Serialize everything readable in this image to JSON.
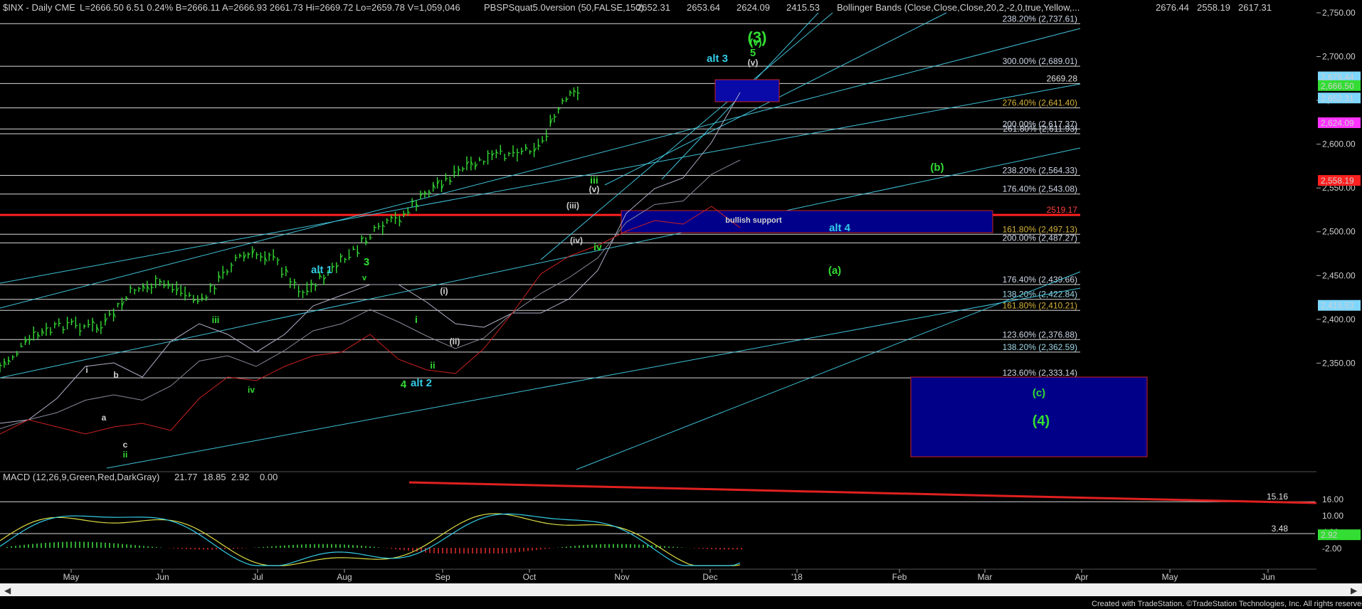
{
  "header": {
    "symbol": "$INX - Daily  CME",
    "quote": "L=2666.50  6.51  0.24%  B=2666.11  A=2666.93  2661.73  Hi=2669.72  Lo=2659.78  V=1,059,046",
    "indicator": "PBSPSquat5.0version (50,FALSE,150)",
    "ind_values": [
      {
        "text": "2652.31",
        "color": "#7fd7ff"
      },
      {
        "text": "2653.64",
        "color": "#ffff66"
      },
      {
        "text": "2624.09",
        "color": "#ff66ff"
      },
      {
        "text": "2415.53",
        "color": "#7fd7ff"
      }
    ],
    "bollinger": "Bollinger Bands (Close,Close,Close,20,2,-2,0,true,Yellow,...",
    "boll_values": [
      {
        "text": "2676.44",
        "color": "#7fd7ff"
      },
      {
        "text": "2558.19",
        "color": "#ff4040"
      },
      {
        "text": "2617.31",
        "color": "#aaaaaa"
      }
    ]
  },
  "colors": {
    "background": "#000000",
    "bars": "#33dd33",
    "channel": "#3fc1d9",
    "wave_green": "#33dd33",
    "wave_cyan": "#33cce6",
    "support_box": "#00008b",
    "box_border": "#cc2222",
    "red_line": "#ff2020"
  },
  "chart_data": [
    {
      "type": "line",
      "name": "price",
      "title": "$INX - Daily",
      "x_axis": {
        "ticks": [
          "May",
          "Jun",
          "Jul",
          "Aug",
          "Sep",
          "Oct",
          "Nov",
          "Dec",
          "'18",
          "Feb",
          "Mar",
          "Apr",
          "May",
          "Jun"
        ]
      },
      "y_axis": {
        "ticks": [
          2350,
          2400,
          2450,
          2500,
          2550,
          2600,
          2650,
          2700,
          2750
        ],
        "ylim": [
          2320,
          2760
        ]
      },
      "grid": false,
      "series": [
        {
          "name": "$INX",
          "x": [
            "2017-04-10",
            "2017-04-24",
            "2017-05-08",
            "2017-05-22",
            "2017-06-05",
            "2017-06-19",
            "2017-07-03",
            "2017-07-17",
            "2017-07-31",
            "2017-08-14",
            "2017-08-28",
            "2017-09-11",
            "2017-09-25",
            "2017-10-09",
            "2017-10-23",
            "2017-11-06",
            "2017-11-20",
            "2017-11-30",
            "2017-12-08"
          ],
          "y": [
            2345,
            2380,
            2395,
            2390,
            2435,
            2440,
            2420,
            2470,
            2475,
            2430,
            2460,
            2495,
            2520,
            2555,
            2575,
            2590,
            2598,
            2645,
            2666
          ]
        }
      ],
      "horizontal_levels": [
        {
          "label": "238.20% (2,737.61)",
          "value": 2737.61
        },
        {
          "label": "300.00% (2,689.01)",
          "value": 2689.01
        },
        {
          "label": "2669.28",
          "value": 2669.28
        },
        {
          "label": "276.40% (2,641.40)",
          "value": 2641.4
        },
        {
          "label": "200.00% (2,617.37)",
          "value": 2617.37
        },
        {
          "label": "261.80% (2,611.93)",
          "value": 2611.93
        },
        {
          "label": "238.20% (2,564.33)",
          "value": 2564.33
        },
        {
          "label": "176.40% (2,543.08)",
          "value": 2543.08
        },
        {
          "label": "2519.17",
          "value": 2519.17
        },
        {
          "label": "161.80% (2,497.13)",
          "value": 2497.13
        },
        {
          "label": "200.00% (2,487.27)",
          "value": 2487.27
        },
        {
          "label": "176.40% (2,439.66)",
          "value": 2439.66
        },
        {
          "label": "138.20% (2,422.84)",
          "value": 2422.84
        },
        {
          "label": "161.80% (2,410.21)",
          "value": 2410.21
        },
        {
          "label": "123.60% (2,376.88)",
          "value": 2376.88
        },
        {
          "label": "138.20% (2,362.59)",
          "value": 2362.59
        },
        {
          "label": "123.60% (2,333.14)",
          "value": 2333.14
        }
      ],
      "price_tags": [
        {
          "text": "2,676.44",
          "value": 2676.44,
          "color": "#7fd7ff"
        },
        {
          "text": "2,666.50",
          "value": 2666.5,
          "color": "#33dd33"
        },
        {
          "text": "2,652.31",
          "value": 2652.31,
          "color": "#7fd7ff"
        },
        {
          "text": "2,624.09",
          "value": 2624.09,
          "color": "#ff33ff"
        },
        {
          "text": "2,558.19",
          "value": 2558.19,
          "color": "#ff2020"
        },
        {
          "text": "2,415.53",
          "value": 2415.53,
          "color": "#7fd7ff"
        }
      ],
      "annotations": [
        "(3)",
        "(v)",
        "5",
        "(v)",
        "alt 3",
        "(b)",
        "bullish support",
        "alt 4",
        "(a)",
        "(c)",
        "(4)",
        "iii",
        "(v)",
        "(iii)",
        "(iv)",
        "iv",
        "alt 1",
        "3",
        "v",
        "iii",
        "i",
        "ii",
        "4",
        "alt 2",
        "(i)",
        "(ii)",
        "i",
        "b",
        "a",
        "c",
        "ii",
        "iv"
      ]
    },
    {
      "type": "line",
      "name": "macd",
      "title": "MACD (12,26,9,Green,Red,DarkGray)",
      "values_shown": [
        "21.77",
        "18.85",
        "2.92",
        "0.00"
      ],
      "y_axis": {
        "ticks": [
          16.0,
          10.0,
          4.0,
          -2.0
        ]
      },
      "levels": [
        {
          "label": "15.16",
          "value": 15.16
        },
        {
          "label": "3.48",
          "value": 3.48
        }
      ],
      "price_tags": [
        {
          "text": "2.92",
          "value": 2.92,
          "color": "#33dd33"
        }
      ]
    }
  ],
  "footer": {
    "credit": "Created with TradeStation. ©TradeStation Technologies, Inc. All rights reserved."
  }
}
